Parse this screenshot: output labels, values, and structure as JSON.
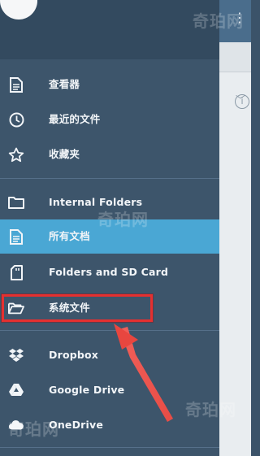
{
  "drawer": {
    "items": [
      {
        "label": "查看器",
        "icon": "document-icon"
      },
      {
        "label": "最近的文件",
        "icon": "clock-icon"
      },
      {
        "label": "收藏夹",
        "icon": "star-icon"
      },
      {
        "label": "Internal Folders",
        "icon": "folder-icon"
      },
      {
        "label": "所有文档",
        "icon": "document-icon"
      },
      {
        "label": "Folders and SD Card",
        "icon": "sd-card-icon"
      },
      {
        "label": "系统文件",
        "icon": "folder-open-icon"
      },
      {
        "label": "Dropbox",
        "icon": "dropbox-icon"
      },
      {
        "label": "Google Drive",
        "icon": "google-drive-icon"
      },
      {
        "label": "OneDrive",
        "icon": "onedrive-icon"
      }
    ],
    "selected_index": 4
  },
  "watermark": "奇珀网",
  "colors": {
    "drawer_bg": "#3d556b",
    "selected_bg": "#4aa7d4",
    "annotation": "#e53030"
  }
}
